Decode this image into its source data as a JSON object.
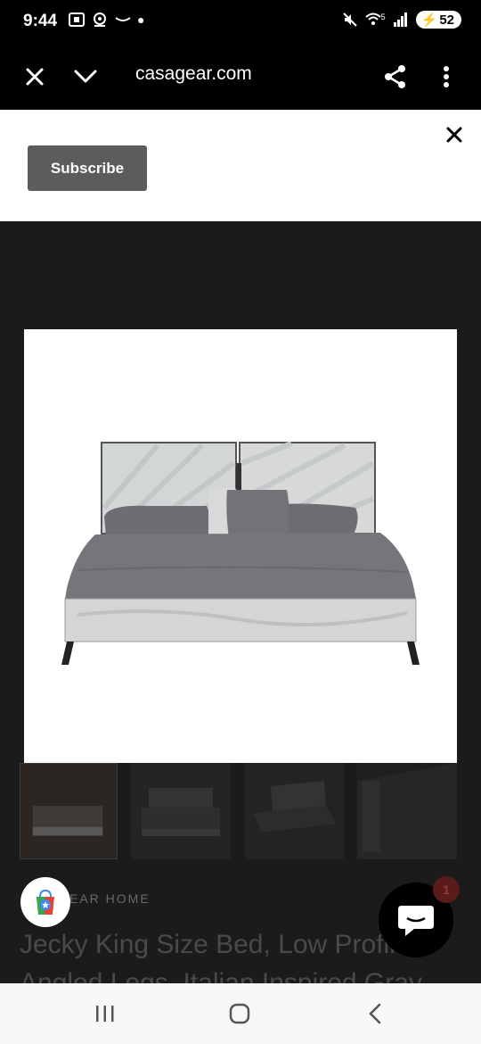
{
  "status_bar": {
    "time": "9:44",
    "battery": "52",
    "wifi_label": "5"
  },
  "browser": {
    "url": "casagear.com"
  },
  "banner": {
    "subscribe_label": "Subscribe"
  },
  "product": {
    "vendor": "CASAGEAR HOME",
    "vendor_visible": "EAR HOME",
    "title": "Jecky King Size Bed, Low Profile, Angled Legs, Italian Inspired Gray",
    "title_line1": "Jecky King Size Bed, Low Profile,",
    "title_line2": "Angled Legs, Italian Inspired Gray"
  },
  "chat": {
    "unread_count": "1"
  },
  "colors": {
    "accent_dark": "#000000",
    "banner_bg": "#ffffff",
    "button_bg": "#5c5c5c",
    "page_bg": "#1b1b1b"
  },
  "icons": [
    "close-icon",
    "chevron-down-icon",
    "share-icon",
    "more-vert-icon",
    "chat-icon",
    "shopping-bag-icon"
  ]
}
